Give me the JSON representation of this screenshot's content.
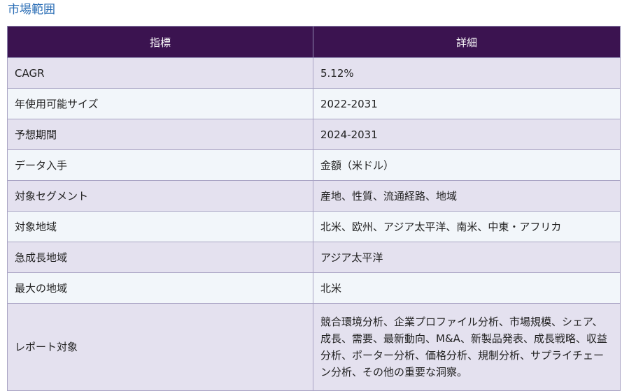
{
  "section": {
    "title": "市場範囲"
  },
  "table": {
    "headers": [
      "指標",
      "詳細"
    ],
    "rows": [
      {
        "label": "CAGR",
        "value": "5.12%"
      },
      {
        "label": "年使用可能サイズ",
        "value": "2022-2031"
      },
      {
        "label": "予想期間",
        "value": "2024-2031"
      },
      {
        "label": "データ入手",
        "value": "金額（米ドル）"
      },
      {
        "label": "対象セグメント",
        "value": "産地、性質、流通経路、地域"
      },
      {
        "label": "対象地域",
        "value": "北米、欧州、アジア太平洋、南米、中東・アフリカ"
      },
      {
        "label": "急成長地域",
        "value": "アジア太平洋"
      },
      {
        "label": "最大の地域",
        "value": "北米"
      },
      {
        "label": "レポート対象",
        "value": "競合環境分析、企業プロファイル分析、市場規模、シェア、成長、需要、最新動向、M&A、新製品発表、成長戦略、収益分析、ポーター分析、価格分析、規制分析、サプライチェーン分析、その他の重要な洞察。"
      }
    ]
  }
}
